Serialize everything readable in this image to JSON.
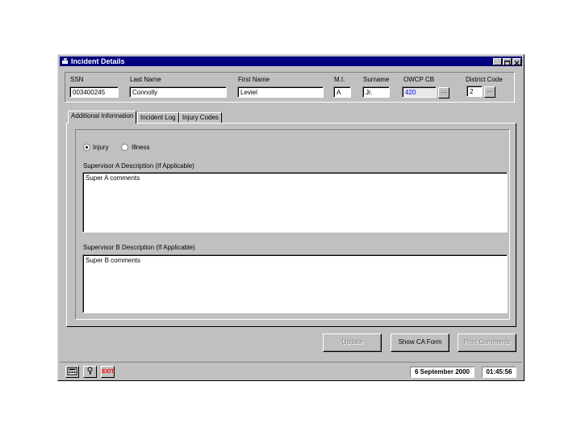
{
  "window": {
    "title": "Incident Details"
  },
  "header": {
    "ssn": {
      "label": "SSN",
      "value": "003400245"
    },
    "last_name": {
      "label": "Last Name",
      "value": "Connolly"
    },
    "first_name": {
      "label": "First Name",
      "value": "Leviel"
    },
    "mi": {
      "label": "M.I.",
      "value": "A"
    },
    "surname": {
      "label": "Surname",
      "value": "Jr."
    },
    "owcp_cb": {
      "label": "OWCP CB",
      "value": "420"
    },
    "district_code": {
      "label": "District Code",
      "value": "2"
    },
    "dots": "..."
  },
  "tabs": [
    {
      "label": "Additional Information"
    },
    {
      "label": "Incident Log"
    },
    {
      "label": "Injury Codes"
    }
  ],
  "panel": {
    "radio_injury": "Injury",
    "radio_illness": "Illness",
    "supervisor_a_label": "Supervisor A Description (If Applicable)",
    "supervisor_a_text": "Super A comments",
    "supervisor_b_label": "Supervisor B Description (If Applicable)",
    "supervisor_b_text": "Super B comments"
  },
  "buttons": {
    "update": "Update",
    "show_ca_form": "Show CA Form",
    "print_comments": "Print Comments"
  },
  "statusbar": {
    "exit": "EXIT",
    "date": "6 September 2000",
    "time": "01:45:56"
  }
}
